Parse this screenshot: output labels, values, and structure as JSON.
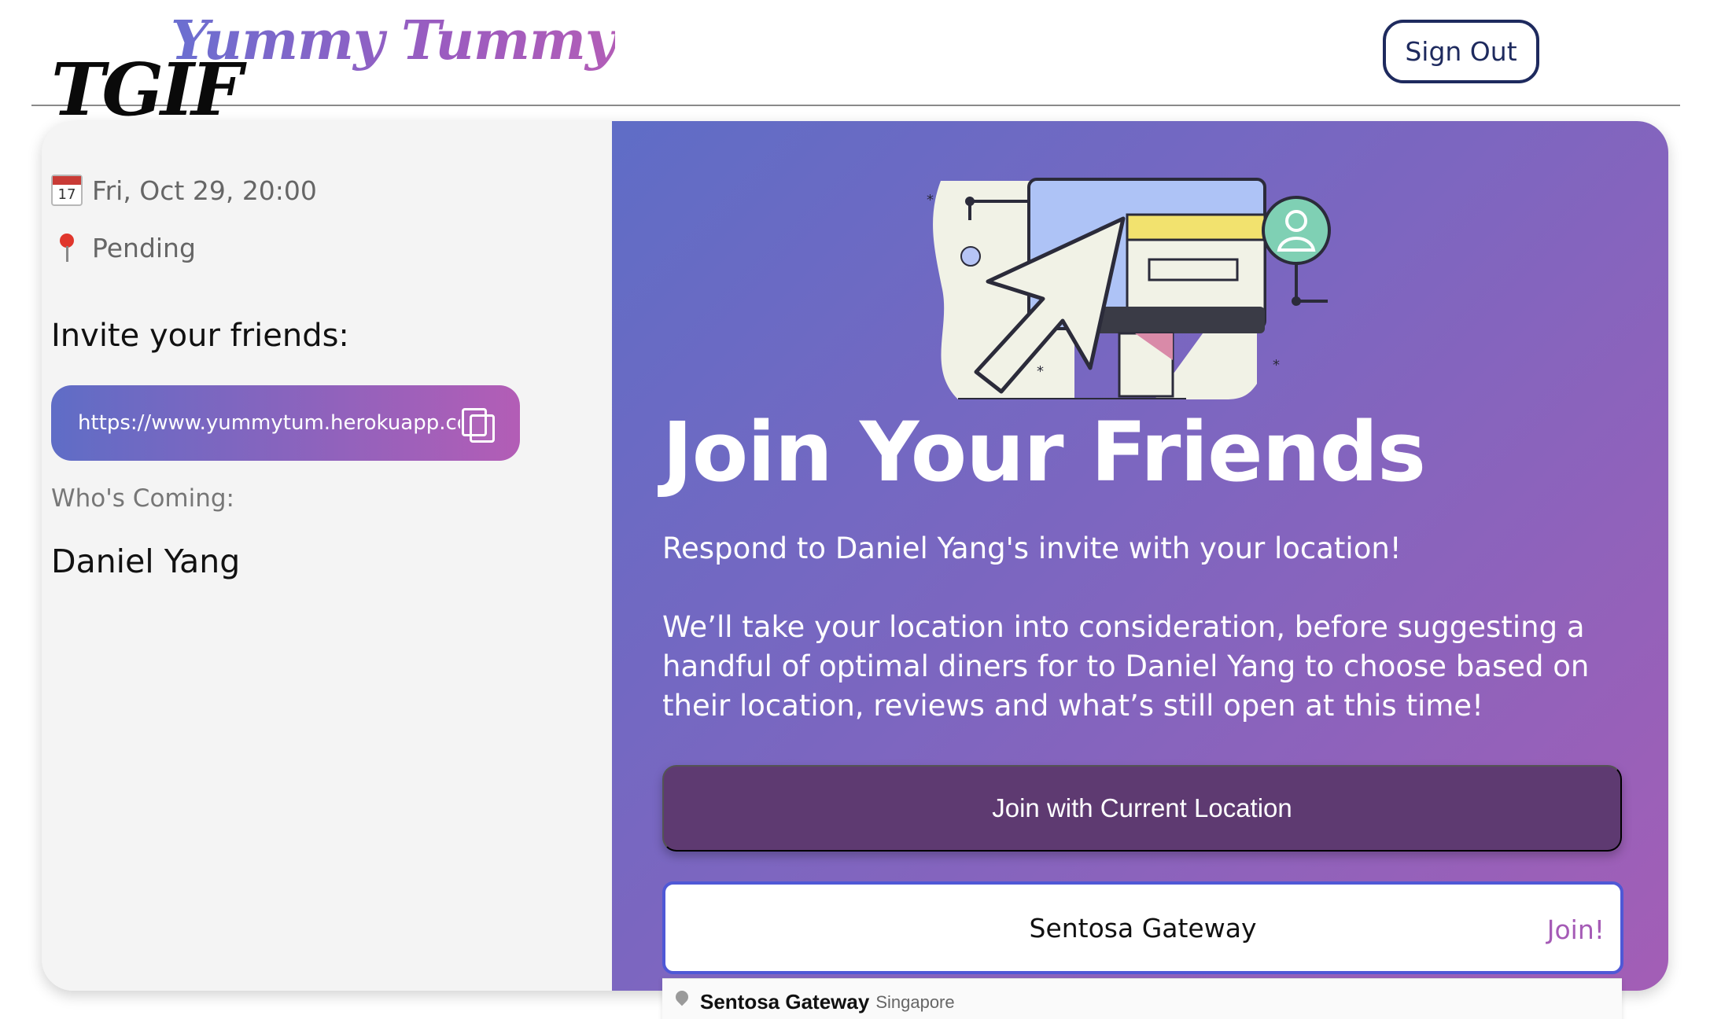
{
  "header": {
    "logo": "Yummy Tummy",
    "sign_out_label": "Sign Out"
  },
  "event": {
    "title": "TGIF",
    "calendar_day": "17",
    "date_text": "Fri, Oct 29, 20:00",
    "status_text": "Pending"
  },
  "invite": {
    "label": "Invite your friends:",
    "link_text": "https://www.yummytum.herokuapp.co"
  },
  "attendees": {
    "label": "Who's Coming:",
    "members": [
      "Daniel Yang"
    ]
  },
  "join": {
    "heading": "Join Your Friends",
    "paragraph_1": "Respond to Daniel Yang's invite with your location!",
    "paragraph_2": "We’ll take your location into consideration, before suggesting a handful of optimal diners for to Daniel Yang to choose based on their location, reviews and what’s still open at this time!",
    "current_location_button": "Join with Current Location",
    "location_input_value": "Sentosa Gateway",
    "join_link": "Join!"
  },
  "suggestion": {
    "main": "Sentosa Gateway",
    "secondary": "Singapore"
  },
  "colors": {
    "brand_start": "#5f6dc6",
    "brand_end": "#b35db6",
    "sign_out_border": "#1e2a5e",
    "current_button_bg": "#5e3a71",
    "join_link": "#a55bb6"
  }
}
